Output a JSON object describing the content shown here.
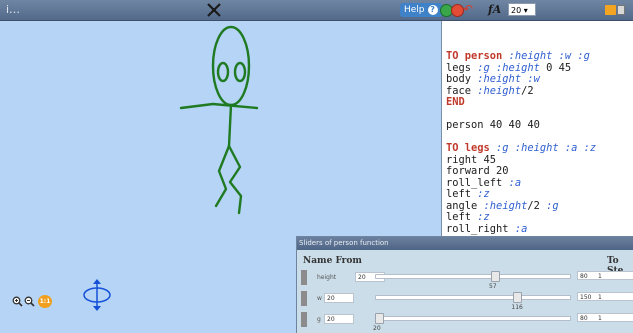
{
  "toolbar": {
    "left_title": "i…",
    "help_label": "Help",
    "font_size": "20 ▾"
  },
  "code": {
    "lines": [
      [
        {
          "t": "TO person ",
          "c": "kw"
        },
        {
          "t": ":height :w :g",
          "c": "var"
        }
      ],
      [
        {
          "t": "legs ",
          "c": ""
        },
        {
          "t": ":g :height",
          "c": "var"
        },
        {
          "t": " 0 45",
          "c": ""
        }
      ],
      [
        {
          "t": "body ",
          "c": ""
        },
        {
          "t": ":height :w",
          "c": "var"
        }
      ],
      [
        {
          "t": "face ",
          "c": ""
        },
        {
          "t": ":height",
          "c": "var"
        },
        {
          "t": "/2",
          "c": ""
        }
      ],
      [
        {
          "t": "END",
          "c": "kw"
        }
      ],
      [
        {
          "t": "",
          "c": ""
        }
      ],
      [
        {
          "t": "person 40 40 40",
          "c": ""
        }
      ],
      [
        {
          "t": "",
          "c": ""
        }
      ],
      [
        {
          "t": "TO legs ",
          "c": "kw"
        },
        {
          "t": ":g :height :a :z",
          "c": "var"
        }
      ],
      [
        {
          "t": "right 45",
          "c": ""
        }
      ],
      [
        {
          "t": "forward 20",
          "c": ""
        }
      ],
      [
        {
          "t": "roll_left ",
          "c": ""
        },
        {
          "t": ":a",
          "c": "var"
        }
      ],
      [
        {
          "t": "left ",
          "c": ""
        },
        {
          "t": ":z",
          "c": "var"
        }
      ],
      [
        {
          "t": "angle ",
          "c": ""
        },
        {
          "t": ":height",
          "c": "var"
        },
        {
          "t": "/2 ",
          "c": ""
        },
        {
          "t": ":g",
          "c": "var"
        }
      ],
      [
        {
          "t": "left ",
          "c": ""
        },
        {
          "t": ":z",
          "c": "var"
        }
      ],
      [
        {
          "t": "roll_right ",
          "c": ""
        },
        {
          "t": ":a",
          "c": "var"
        }
      ]
    ]
  },
  "sliders": {
    "title": "Sliders of person function",
    "col_name_from": "Name From",
    "col_to_step": "To Ste",
    "params": [
      {
        "name": "height",
        "from": "20",
        "current": "57",
        "to": "80",
        "step": "1",
        "fraction": 0.62
      },
      {
        "name": "w",
        "from": "20",
        "current": "116",
        "to": "150",
        "step": "1",
        "fraction": 0.74
      },
      {
        "name": "g",
        "from": "20",
        "current": "20",
        "to": "80",
        "step": "1",
        "fraction": 0.0
      }
    ]
  },
  "colors": {
    "canvas": "#b5d4f6",
    "figure_stroke": "#1f7a22",
    "keyword": "#c0392b",
    "variable": "#2f5fd0"
  },
  "icons": {
    "app_logo": "crossed-tools-icon",
    "run": "green-circle-icon",
    "stop": "red-circle-icon",
    "undo": "undo-arrow-icon",
    "font": "font-size-icon",
    "zoom_in": "zoom-in-icon",
    "zoom_out": "zoom-out-icon",
    "zoom_reset": "zoom-reset-icon",
    "move": "rotate-move-icon"
  }
}
